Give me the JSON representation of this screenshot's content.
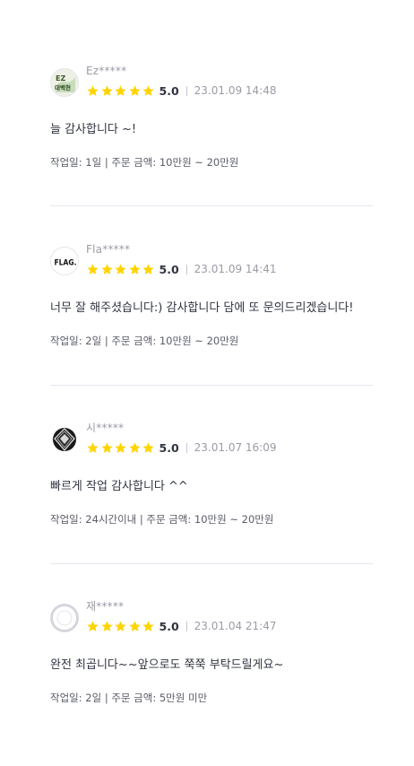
{
  "reviews": [
    {
      "nickname": "Ez*****",
      "avatar": "ez-logo-icon",
      "avatar_text": "EZ\n대백현",
      "rating": 5,
      "score": "5.0",
      "date": "23.01.09 14:48",
      "comment": "늘 감사합니다 ~!",
      "info": "작업일: 1일 | 주문 금액: 10만원 ~ 20만원"
    },
    {
      "nickname": "Fla*****",
      "avatar": "flag-logo-icon",
      "avatar_text": "FLAG.",
      "rating": 5,
      "score": "5.0",
      "date": "23.01.09 14:41",
      "comment": "너무 잘 해주셨습니다:) 감사합니다 담에 또 문의드리겠습니다!",
      "info": "작업일: 2일 | 주문 금액: 10만원 ~ 20만원"
    },
    {
      "nickname": "시*****",
      "avatar": "diamond-logo-icon",
      "rating": 5,
      "score": "5.0",
      "date": "23.01.07 16:09",
      "comment": "빠르게 작업 감사합니다 ^^",
      "info": "작업일: 24시간이내 | 주문 금액: 10만원 ~ 20만원"
    },
    {
      "nickname": "재*****",
      "avatar": "default-user-icon",
      "rating": 5,
      "score": "5.0",
      "date": "23.01.04 21:47",
      "comment": "완전 최곱니다~~앞으로도 쭉쭉 부탁드릴게요~",
      "info": "작업일: 2일 | 주문 금액: 5만원 미만"
    }
  ],
  "colors": {
    "star": "#ffd400",
    "divider": "#e4e5ed",
    "text": "#303441",
    "muted": "#9a9ba7"
  }
}
